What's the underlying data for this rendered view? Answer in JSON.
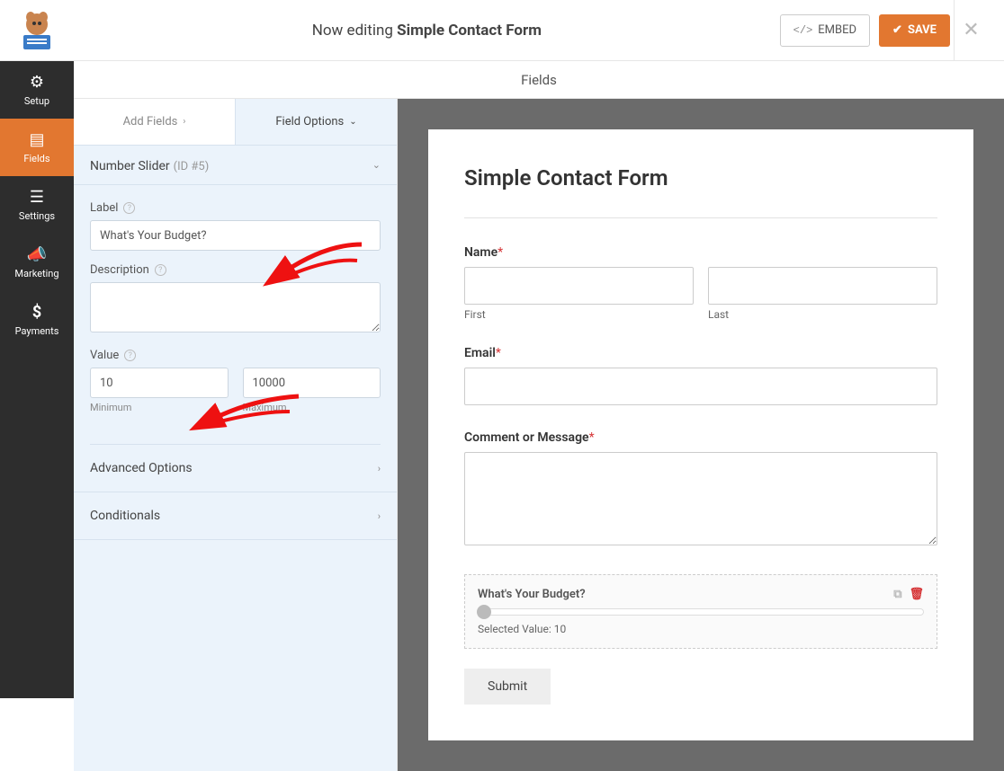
{
  "header": {
    "editing_prefix": "Now editing ",
    "form_name": "Simple Contact Form",
    "embed_label": "EMBED",
    "save_label": "SAVE"
  },
  "sidebar": {
    "items": [
      {
        "label": "Setup"
      },
      {
        "label": "Fields"
      },
      {
        "label": "Settings"
      },
      {
        "label": "Marketing"
      },
      {
        "label": "Payments"
      }
    ]
  },
  "panel": {
    "fields_header": "Fields",
    "tab_add": "Add Fields",
    "tab_options": "Field Options",
    "field_type": "Number Slider",
    "field_id": "(ID #5)",
    "label_label": "Label",
    "label_value": "What's Your Budget?",
    "desc_label": "Description",
    "value_label": "Value",
    "min_value": "10",
    "max_value": "10000",
    "min_sub": "Minimum",
    "max_sub": "Maximum",
    "adv_options": "Advanced Options",
    "conditionals": "Conditionals"
  },
  "form": {
    "title": "Simple Contact Form",
    "name_label": "Name",
    "first_sub": "First",
    "last_sub": "Last",
    "email_label": "Email",
    "comment_label": "Comment or Message",
    "slider_label": "What's Your Budget?",
    "selected_value": "Selected Value: 10",
    "submit_label": "Submit"
  }
}
